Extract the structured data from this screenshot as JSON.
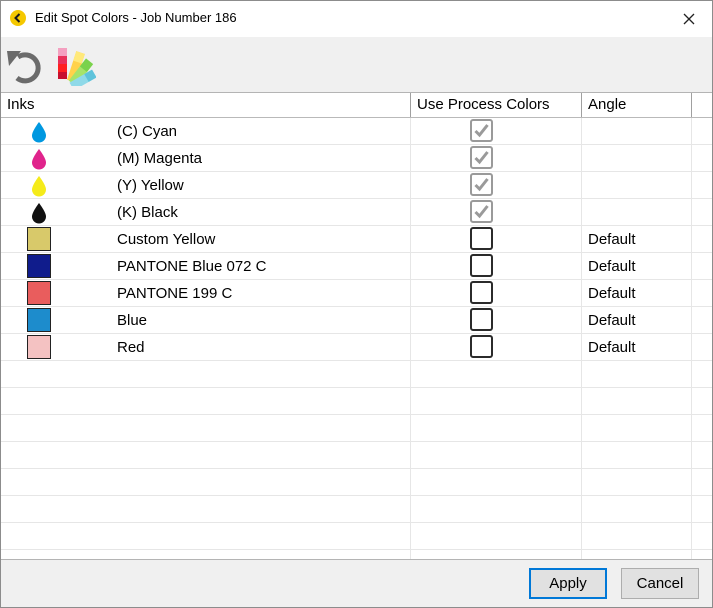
{
  "window": {
    "title": "Edit Spot Colors - Job Number 186"
  },
  "toolbar": {
    "undo_icon": "undo-icon",
    "palette_icon": "color-palette-icon"
  },
  "columns": {
    "inks": "Inks",
    "use_process": "Use Process Colors",
    "angle": "Angle"
  },
  "inks": [
    {
      "name": "(C) Cyan",
      "icon": "drop",
      "color": "#0098e0",
      "checked": true,
      "disabled": true,
      "angle": ""
    },
    {
      "name": "(M) Magenta",
      "icon": "drop",
      "color": "#e0248c",
      "checked": true,
      "disabled": true,
      "angle": ""
    },
    {
      "name": "(Y) Yellow",
      "icon": "drop",
      "color": "#f5eb1a",
      "checked": true,
      "disabled": true,
      "angle": ""
    },
    {
      "name": "(K) Black",
      "icon": "drop",
      "color": "#111111",
      "checked": true,
      "disabled": true,
      "angle": ""
    },
    {
      "name": "Custom Yellow",
      "icon": "swatch",
      "color": "#d8c96a",
      "checked": false,
      "disabled": false,
      "angle": "Default"
    },
    {
      "name": "PANTONE Blue 072 C",
      "icon": "swatch",
      "color": "#101c8c",
      "checked": false,
      "disabled": false,
      "angle": "Default"
    },
    {
      "name": "PANTONE 199 C",
      "icon": "swatch",
      "color": "#e95d5d",
      "checked": false,
      "disabled": false,
      "angle": "Default"
    },
    {
      "name": "Blue",
      "icon": "swatch",
      "color": "#1d8ccc",
      "checked": false,
      "disabled": false,
      "angle": "Default"
    },
    {
      "name": "Red",
      "icon": "swatch",
      "color": "#f4c2c2",
      "checked": false,
      "disabled": false,
      "angle": "Default"
    }
  ],
  "empty_rows": 7,
  "buttons": {
    "apply": "Apply",
    "cancel": "Cancel"
  },
  "colors": {
    "accent": "#0078d7",
    "app_icon": "#f5c800"
  }
}
